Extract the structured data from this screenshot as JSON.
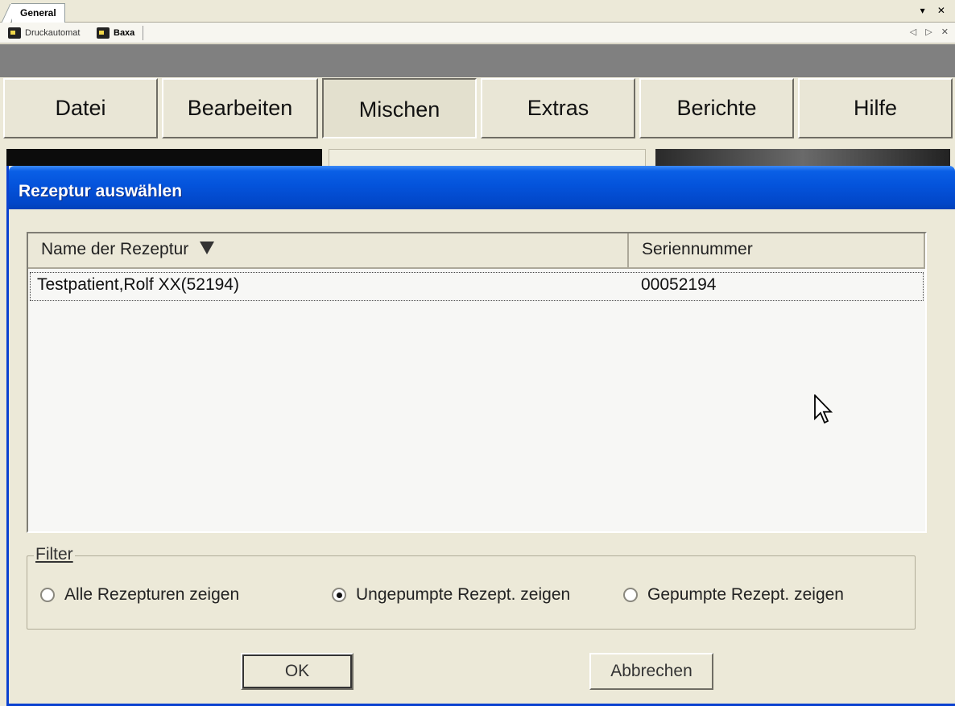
{
  "tabstrip": {
    "active_tab": "General",
    "controls": "▾ ✕"
  },
  "subbar": {
    "items": [
      {
        "label": "Druckautomat",
        "icon": "app-icon"
      },
      {
        "label": "Baxa",
        "icon": "app-icon"
      }
    ],
    "controls": "◁ ▷ ✕"
  },
  "menu": {
    "items": [
      {
        "label": "Datei"
      },
      {
        "label": "Bearbeiten"
      },
      {
        "label": "Mischen",
        "active": true
      },
      {
        "label": "Extras"
      },
      {
        "label": "Berichte"
      },
      {
        "label": "Hilfe"
      }
    ]
  },
  "dialog": {
    "title": "Rezeptur auswählen",
    "columns": [
      "Name der Rezeptur",
      "Seriennummer"
    ],
    "rows": [
      {
        "name": "Testpatient,Rolf XX(52194)",
        "serial": "00052194"
      }
    ],
    "filter": {
      "legend": "Filter",
      "options": [
        {
          "label": "Alle Rezepturen zeigen",
          "checked": false
        },
        {
          "label": "Ungepumpte Rezept. zeigen",
          "checked": true
        },
        {
          "label": "Gepumpte Rezept. zeigen",
          "checked": false
        }
      ]
    },
    "ok_label": "OK",
    "cancel_label": "Abbrechen"
  },
  "colors": {
    "titlebar": "#0453db",
    "menubar_bg": "#808080",
    "dialog_bg": "#ece9d8"
  }
}
